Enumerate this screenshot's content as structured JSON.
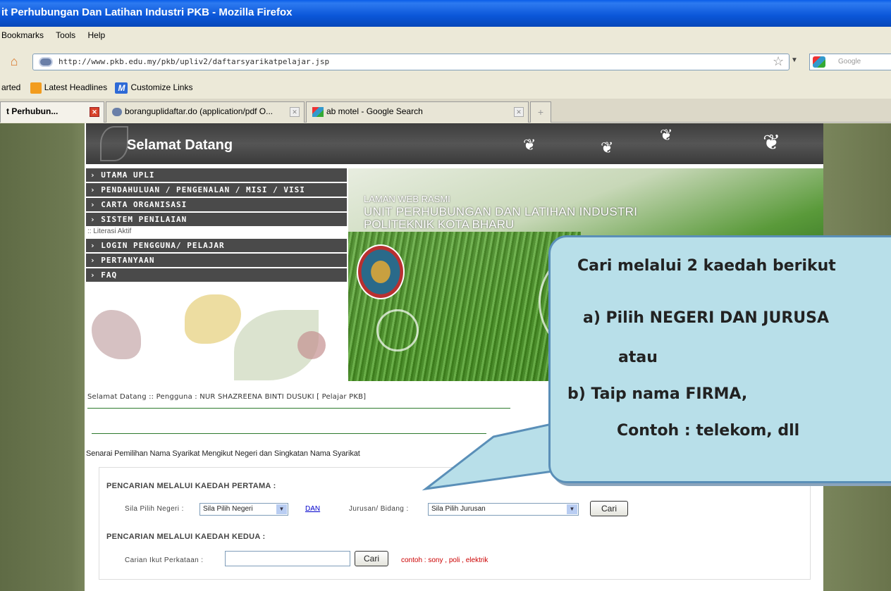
{
  "browser": {
    "title": "it Perhubungan Dan Latihan Industri PKB - Mozilla Firefox",
    "menu": {
      "bookmarks": "Bookmarks",
      "tools": "Tools",
      "help": "Help"
    },
    "url": "http://www.pkb.edu.my/pkb/upliv2/daftarsyarikatpelajar.jsp",
    "search_placeholder": "Google",
    "bookmarks_bar": {
      "started": "arted",
      "latest_headlines": "Latest Headlines",
      "customize_links": "Customize Links"
    },
    "tabs": [
      {
        "label": "t Perhubun..."
      },
      {
        "label": "boranguplidaftar.do (application/pdf O..."
      },
      {
        "label": "ab motel - Google Search"
      }
    ],
    "new_tab": "+"
  },
  "page": {
    "header_title": "Selamat Datang",
    "menu": [
      "› UTAMA UPLI",
      "› PENDAHULUAN / PENGENALAN / MISI / VISI",
      "› CARTA ORGANISASI",
      "› SISTEM PENILAIAN",
      ":: Literasi Aktif",
      "› LOGIN PENGGUNA/ PELAJAR",
      "› PERTANYAAN",
      "› FAQ"
    ],
    "banner": {
      "line1": "LAMAN WEB RASMI",
      "line2": "UNIT PERHUBUNGAN DAN LATIHAN INDUSTRI",
      "line3": "POLITEKNIK KOTA BHARU"
    },
    "welcome": "Selamat Datang :: Pengguna : NUR SHAZREENA BINTI DUSUKI [ Pelajar PKB]",
    "list_title": "Senarai Pemilihan Nama Syarikat Mengikut Negeri dan Singkatan Nama Syarikat",
    "search1": {
      "heading": "PENCARIAN MELALUI KAEDAH PERTAMA :",
      "negeri_label": "Sila Pilih Negeri :",
      "negeri_value": "Sila Pilih Negeri",
      "dan": "DAN",
      "jurusan_label": "Jurusan/ Bidang :",
      "jurusan_value": "Sila Pilih Jurusan",
      "button": "Cari"
    },
    "search2": {
      "heading": "PENCARIAN MELALUI KAEDAH KEDUA :",
      "label": "Carian Ikut Perkataan :",
      "button": "Cari",
      "hint": "contoh : sony , poli , elektrik"
    }
  },
  "callout": {
    "line1": "Cari melalui 2 kaedah berikut",
    "line2": "a)  Pilih NEGERI DAN JURUSA",
    "line3": "atau",
    "line4": "b)  Taip nama FIRMA,",
    "line5": "Contoh : telekom, dll"
  }
}
